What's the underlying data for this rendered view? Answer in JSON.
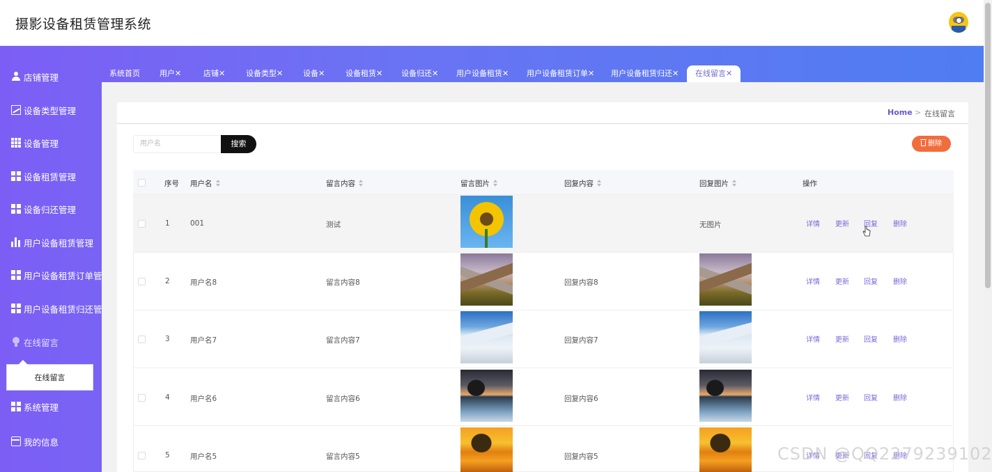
{
  "app": {
    "title": "摄影设备租赁管理系统"
  },
  "sidebar": {
    "items": [
      {
        "label": "店铺管理",
        "icon": "user-icon"
      },
      {
        "label": "设备类型管理",
        "icon": "chart-line-icon"
      },
      {
        "label": "设备管理",
        "icon": "grid-icon"
      },
      {
        "label": "设备租赁管理",
        "icon": "grid-icon"
      },
      {
        "label": "设备归还管理",
        "icon": "grid-icon"
      },
      {
        "label": "用户设备租赁管理",
        "icon": "bar-chart-icon"
      },
      {
        "label": "用户设备租赁订单管理",
        "icon": "grid-icon"
      },
      {
        "label": "用户设备租赁归还管理",
        "icon": "grid-icon"
      },
      {
        "label": "在线留言",
        "icon": "bulb-icon"
      },
      {
        "label": "系统管理",
        "icon": "grid-icon"
      },
      {
        "label": "我的信息",
        "icon": "card-icon"
      }
    ],
    "submenu_label": "在线留言"
  },
  "tabs": [
    {
      "label": "系统首页"
    },
    {
      "label": "用户✕"
    },
    {
      "label": "店铺✕"
    },
    {
      "label": "设备类型✕"
    },
    {
      "label": "设备✕"
    },
    {
      "label": "设备租赁✕"
    },
    {
      "label": "设备归还✕"
    },
    {
      "label": "用户设备租赁✕"
    },
    {
      "label": "用户设备租赁订单✕"
    },
    {
      "label": "用户设备租赁归还✕"
    },
    {
      "label": "在线留言✕",
      "active": true
    }
  ],
  "breadcrumb": {
    "home": "Home",
    "sep": ">",
    "current": "在线留言"
  },
  "search": {
    "placeholder": "用户名",
    "button_label": "搜索"
  },
  "toolbar": {
    "delete_label": "删除"
  },
  "table": {
    "headers": [
      "序号",
      "用户名",
      "留言内容",
      "留言图片",
      "回复内容",
      "回复图片",
      "操作"
    ],
    "actions": [
      "详情",
      "更新",
      "回复",
      "删除"
    ],
    "rows": [
      {
        "index": "1",
        "username": "001",
        "content": "测试",
        "reply": "",
        "reply_image_text": "无图片"
      },
      {
        "index": "2",
        "username": "用户名8",
        "content": "留言内容8",
        "reply": "回复内容8",
        "reply_image_text": ""
      },
      {
        "index": "3",
        "username": "用户名7",
        "content": "留言内容7",
        "reply": "回复内容7",
        "reply_image_text": ""
      },
      {
        "index": "4",
        "username": "用户名6",
        "content": "留言内容6",
        "reply": "回复内容6",
        "reply_image_text": ""
      },
      {
        "index": "5",
        "username": "用户名5",
        "content": "留言内容5",
        "reply": "回复内容5",
        "reply_image_text": ""
      }
    ]
  },
  "watermark": "CSDN @QQ2279239102",
  "colors": {
    "accent": "#6a5acd",
    "sidebar_from": "#7d5ef5",
    "sidebar_to": "#4f7df2",
    "delete": "#f26d3d"
  }
}
